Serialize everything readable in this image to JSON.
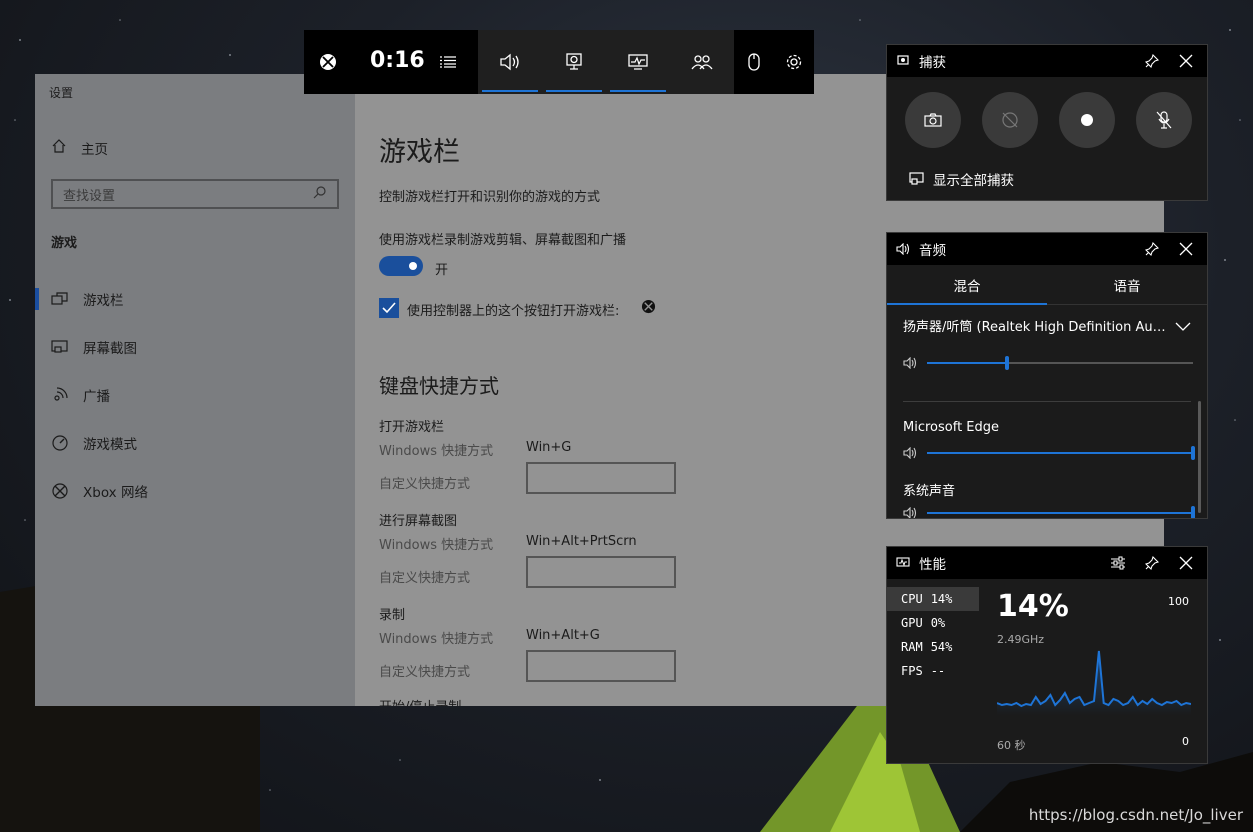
{
  "settings": {
    "window_title": "设置",
    "nav": {
      "home": "主页",
      "search_placeholder": "查找设置",
      "section": "游戏",
      "items": [
        {
          "label": "游戏栏",
          "icon": "game-bar-icon"
        },
        {
          "label": "屏幕截图",
          "icon": "screenshot-icon"
        },
        {
          "label": "广播",
          "icon": "broadcast-icon"
        },
        {
          "label": "游戏模式",
          "icon": "game-mode-icon"
        },
        {
          "label": "Xbox 网络",
          "icon": "xbox-icon"
        }
      ]
    },
    "content": {
      "title": "游戏栏",
      "description": "控制游戏栏打开和识别你的游戏的方式",
      "record_label": "使用游戏栏录制游戏剪辑、屏幕截图和广播",
      "toggle_state": "开",
      "controller_checkbox": "使用控制器上的这个按钮打开游戏栏:",
      "keyboard_heading": "键盘快捷方式",
      "shortcuts": [
        {
          "title": "打开游戏栏",
          "windows_label": "Windows 快捷方式",
          "windows_value": "Win+G",
          "custom_label": "自定义快捷方式"
        },
        {
          "title": "进行屏幕截图",
          "windows_label": "Windows 快捷方式",
          "windows_value": "Win+Alt+PrtScrn",
          "custom_label": "自定义快捷方式"
        },
        {
          "title": "录制",
          "windows_label": "Windows 快捷方式",
          "windows_value": "Win+Alt+G",
          "custom_label": "自定义快捷方式"
        }
      ],
      "cut_off_text": "开始/停止录制"
    }
  },
  "gamebar": {
    "timer": "0:16",
    "buttons": [
      "xbox-icon",
      "menu-icon",
      "audio-icon",
      "capture-icon",
      "performance-icon",
      "social-icon",
      "mouse-icon",
      "gear-icon"
    ]
  },
  "capture_panel": {
    "title": "捕获",
    "show_all": "显示全部捕获"
  },
  "audio_panel": {
    "title": "音频",
    "tabs": [
      "混合",
      "语音"
    ],
    "device": "扬声器/听筒 (Realtek High Definition Aud...",
    "apps": [
      {
        "name": "Microsoft Edge",
        "level": 1.0
      },
      {
        "name": "系统声音",
        "level": 1.0
      }
    ],
    "device_level": 0.3
  },
  "perf_panel": {
    "title": "性能",
    "metrics": [
      {
        "name": "CPU",
        "value": "14%"
      },
      {
        "name": "GPU",
        "value": "0%"
      },
      {
        "name": "RAM",
        "value": "54%"
      },
      {
        "name": "FPS",
        "value": "--"
      }
    ],
    "big_value": "14%",
    "frequency": "2.49GHz",
    "max_label": "100",
    "time_label": "60 秒",
    "min_label": "0",
    "cpu_history": [
      12,
      10,
      11,
      10,
      12,
      9,
      11,
      10,
      18,
      11,
      14,
      20,
      10,
      15,
      22,
      12,
      16,
      18,
      10,
      12,
      14,
      64,
      12,
      10,
      16,
      14,
      10,
      12,
      18,
      10,
      14,
      11,
      16,
      12,
      10,
      13,
      12,
      14,
      10,
      12,
      11
    ]
  },
  "watermark": "https://blog.csdn.net/Jo_liver",
  "colors": {
    "accent": "#1e74d6",
    "toggle": "#1a4f9c"
  }
}
